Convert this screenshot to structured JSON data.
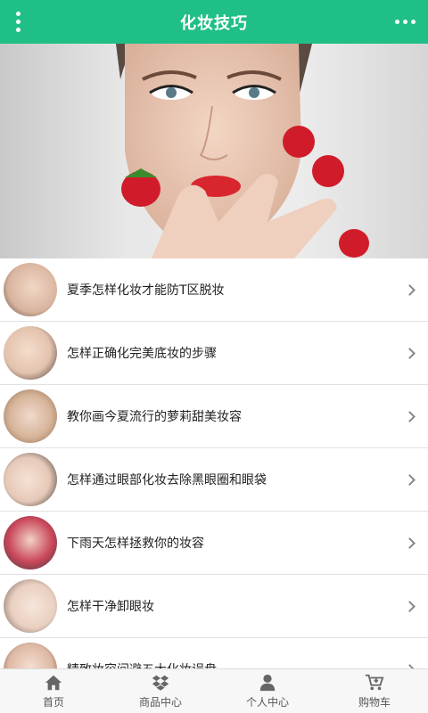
{
  "header": {
    "title": "化妆技巧",
    "menu_icon": "vertical-dots-icon",
    "more_icon": "horizontal-dots-icon",
    "background": "#1fbf86"
  },
  "banner": {
    "image": "woman-with-strawberries-photo"
  },
  "articles": [
    {
      "title": "夏季怎样化妆才能防T区脱妆",
      "thumb": "face-makeup-photo"
    },
    {
      "title": "怎样正确化完美底妆的步骤",
      "thumb": "foundation-brush-photo"
    },
    {
      "title": "教你画今夏流行的萝莉甜美妆容",
      "thumb": "sweet-makeup-photo"
    },
    {
      "title": "怎样通过眼部化妆去除黑眼圈和眼袋",
      "thumb": "eye-makeup-photo"
    },
    {
      "title": "下雨天怎样拯救你的妆容",
      "thumb": "rainy-day-makeup-photo"
    },
    {
      "title": "怎样干净卸眼妆",
      "thumb": "eye-makeup-removal-photo"
    },
    {
      "title": "精致妆容间避五大化妆误盘",
      "thumb": "delicate-makeup-photo"
    }
  ],
  "tabbar": {
    "tabs": [
      {
        "label": "首页",
        "icon": "home-icon"
      },
      {
        "label": "商品中心",
        "icon": "dropbox-icon"
      },
      {
        "label": "个人中心",
        "icon": "user-icon"
      },
      {
        "label": "购物车",
        "icon": "cart-icon"
      }
    ]
  }
}
